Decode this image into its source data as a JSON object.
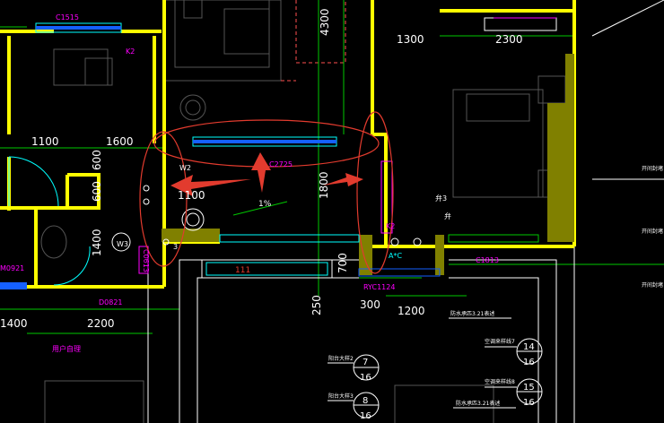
{
  "dims": {
    "d1100_top": "1100",
    "d1600": "1600",
    "d600": "600",
    "d1400": "1400",
    "d1100_mid": "1100",
    "d1800": "1800",
    "d700": "700",
    "d250": "250",
    "d300": "300",
    "d1200": "1200",
    "d1300": "1300",
    "d2300": "2300",
    "d4300": "4300",
    "d2200": "2200",
    "d1400_left": "1400",
    "d600_b": "600"
  },
  "labels": {
    "c1515": "C1515",
    "k2_top": "K2",
    "window_c2725": "C2725",
    "w2": "W2",
    "w3": "W3",
    "k2_right": "K2",
    "axc": "A*C",
    "ryc": "RYC1124",
    "c1813": "C1813",
    "m0921": "M0921",
    "d0821": "D0821",
    "c0613": "C0613",
    "slope": "1%",
    "pct3": "3",
    "eq3": "弁3",
    "eq1": "弁",
    "household": "用户自理",
    "red_pipe": "111"
  },
  "legend": {
    "row1_label": "阳台大样2",
    "row1_val": "7",
    "row1_sub": "16",
    "row2_label": "阳台大样3",
    "row2_val": "8",
    "row2_sub": "16",
    "r_label1": "空调来样线7",
    "r_val1": "14",
    "r_sub1": "16",
    "r_label2": "空调来样线8",
    "r_val2": "15",
    "r_sub2": "16",
    "note_top": "防水承匹3.21表述",
    "note_bottom": "防水承匹3.21表述",
    "side_note": "开间封堵",
    "side_note2": "开间封堵",
    "side_note3": "开间封堵"
  },
  "colors": {
    "wall": "#ffff00",
    "dim": "#ffffff",
    "green": "#00c800",
    "red": "#e23b2e",
    "magenta": "#ff00ff",
    "cyan": "#00ffff",
    "blue": "#1560ff"
  }
}
